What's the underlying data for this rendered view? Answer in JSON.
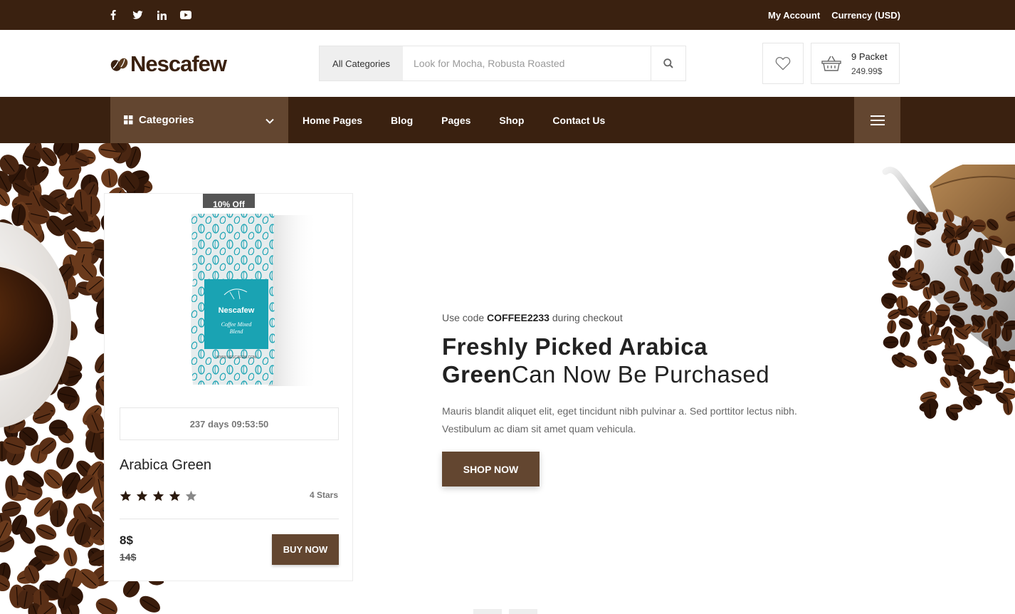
{
  "topbar": {
    "social": [
      "facebook-icon",
      "twitter-icon",
      "linkedin-icon",
      "youtube-icon"
    ],
    "my_account": "My Account",
    "currency": "Currency (USD)"
  },
  "header": {
    "logo_text": "Nescafew",
    "search": {
      "category": "All Categories",
      "placeholder": "Look for Mocha, Robusta Roasted"
    },
    "cart": {
      "packets": "9 Packet",
      "total": "249.99$"
    }
  },
  "nav": {
    "categories_label": "Categories",
    "items": [
      "Home Pages",
      "Blog",
      "Pages",
      "Shop",
      "Contact Us"
    ]
  },
  "product": {
    "badge": "10% Off",
    "pack_brand": "Nescafew",
    "pack_line1": "Coffee Mixed",
    "pack_line2": "Blend",
    "pack_site": "WWW.NESCAFEW.COM",
    "countdown": "237 days 09:53:50",
    "name": "Arabica Green",
    "rating": 4,
    "rating_max": 5,
    "rating_label": "4 Stars",
    "price": "8$",
    "old_price": "14$",
    "buy_label": "BUY NOW"
  },
  "hero": {
    "promo_prefix": "Use code",
    "promo_code": "COFFEE2233",
    "promo_suffix": "during checkout",
    "headline_bold_1": "Freshly Picked Arabica",
    "headline_bold_2": "Green",
    "headline_rest": "Can Now Be Purchased",
    "description": "Mauris blandit aliquet elit, eget tincidunt nibh pulvinar a. Sed porttitor lectus nibh. Vestibulum ac diam sit amet quam vehicula.",
    "cta": "SHOP NOW"
  },
  "colors": {
    "dark_brown": "#3a2110",
    "medium_brown": "#634630",
    "teal": "#1aa3b3"
  }
}
